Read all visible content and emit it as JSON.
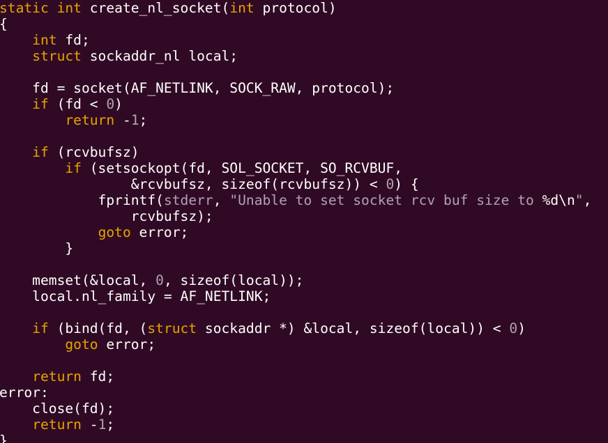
{
  "editor": {
    "language": "c",
    "colors": {
      "background": "#300a24",
      "text": "#ffffff",
      "keyword": "#e6a400",
      "literal": "#b2a1b5"
    },
    "lines": [
      [
        {
          "t": "kw",
          "v": "static int"
        },
        {
          "t": "txt",
          "v": " create_nl_socket("
        },
        {
          "t": "kw",
          "v": "int"
        },
        {
          "t": "txt",
          "v": " protocol)"
        }
      ],
      [
        {
          "t": "txt",
          "v": "{"
        }
      ],
      [
        {
          "t": "txt",
          "v": "    "
        },
        {
          "t": "kw",
          "v": "int"
        },
        {
          "t": "txt",
          "v": " fd;"
        }
      ],
      [
        {
          "t": "txt",
          "v": "    "
        },
        {
          "t": "kw",
          "v": "struct"
        },
        {
          "t": "txt",
          "v": " sockaddr_nl local;"
        }
      ],
      [],
      [
        {
          "t": "txt",
          "v": "    fd = socket(AF_NETLINK, SOCK_RAW, protocol);"
        }
      ],
      [
        {
          "t": "txt",
          "v": "    "
        },
        {
          "t": "kw",
          "v": "if"
        },
        {
          "t": "txt",
          "v": " (fd < "
        },
        {
          "t": "lit",
          "v": "0"
        },
        {
          "t": "txt",
          "v": ")"
        }
      ],
      [
        {
          "t": "txt",
          "v": "        "
        },
        {
          "t": "kw",
          "v": "return"
        },
        {
          "t": "txt",
          "v": " -"
        },
        {
          "t": "lit",
          "v": "1"
        },
        {
          "t": "txt",
          "v": ";"
        }
      ],
      [],
      [
        {
          "t": "txt",
          "v": "    "
        },
        {
          "t": "kw",
          "v": "if"
        },
        {
          "t": "txt",
          "v": " (rcvbufsz)"
        }
      ],
      [
        {
          "t": "txt",
          "v": "        "
        },
        {
          "t": "kw",
          "v": "if"
        },
        {
          "t": "txt",
          "v": " (setsockopt(fd, SOL_SOCKET, SO_RCVBUF,"
        }
      ],
      [
        {
          "t": "txt",
          "v": "                &rcvbufsz, sizeof(rcvbufsz)) < "
        },
        {
          "t": "lit",
          "v": "0"
        },
        {
          "t": "txt",
          "v": ") {"
        }
      ],
      [
        {
          "t": "txt",
          "v": "            fprintf("
        },
        {
          "t": "lit",
          "v": "stderr"
        },
        {
          "t": "txt",
          "v": ", "
        },
        {
          "t": "lit",
          "v": "\"Unable to set socket rcv buf size to "
        },
        {
          "t": "txt",
          "v": "%d\\n"
        },
        {
          "t": "lit",
          "v": "\""
        },
        {
          "t": "txt",
          "v": ","
        }
      ],
      [
        {
          "t": "txt",
          "v": "                rcvbufsz);"
        }
      ],
      [
        {
          "t": "txt",
          "v": "            "
        },
        {
          "t": "kw",
          "v": "goto"
        },
        {
          "t": "txt",
          "v": " error;"
        }
      ],
      [
        {
          "t": "txt",
          "v": "        }"
        }
      ],
      [],
      [
        {
          "t": "txt",
          "v": "    memset(&local, "
        },
        {
          "t": "lit",
          "v": "0"
        },
        {
          "t": "txt",
          "v": ", sizeof(local));"
        }
      ],
      [
        {
          "t": "txt",
          "v": "    local.nl_family = AF_NETLINK;"
        }
      ],
      [],
      [
        {
          "t": "txt",
          "v": "    "
        },
        {
          "t": "kw",
          "v": "if"
        },
        {
          "t": "txt",
          "v": " (bind(fd, ("
        },
        {
          "t": "kw",
          "v": "struct"
        },
        {
          "t": "txt",
          "v": " sockaddr *) &local, sizeof(local)) < "
        },
        {
          "t": "lit",
          "v": "0"
        },
        {
          "t": "txt",
          "v": ")"
        }
      ],
      [
        {
          "t": "txt",
          "v": "        "
        },
        {
          "t": "kw",
          "v": "goto"
        },
        {
          "t": "txt",
          "v": " error;"
        }
      ],
      [],
      [
        {
          "t": "txt",
          "v": "    "
        },
        {
          "t": "kw",
          "v": "return"
        },
        {
          "t": "txt",
          "v": " fd;"
        }
      ],
      [
        {
          "t": "txt",
          "v": "error:"
        }
      ],
      [
        {
          "t": "txt",
          "v": "    close(fd);"
        }
      ],
      [
        {
          "t": "txt",
          "v": "    "
        },
        {
          "t": "kw",
          "v": "return"
        },
        {
          "t": "txt",
          "v": " -"
        },
        {
          "t": "lit",
          "v": "1"
        },
        {
          "t": "txt",
          "v": ";"
        }
      ],
      [
        {
          "t": "txt",
          "v": "}"
        }
      ]
    ]
  }
}
